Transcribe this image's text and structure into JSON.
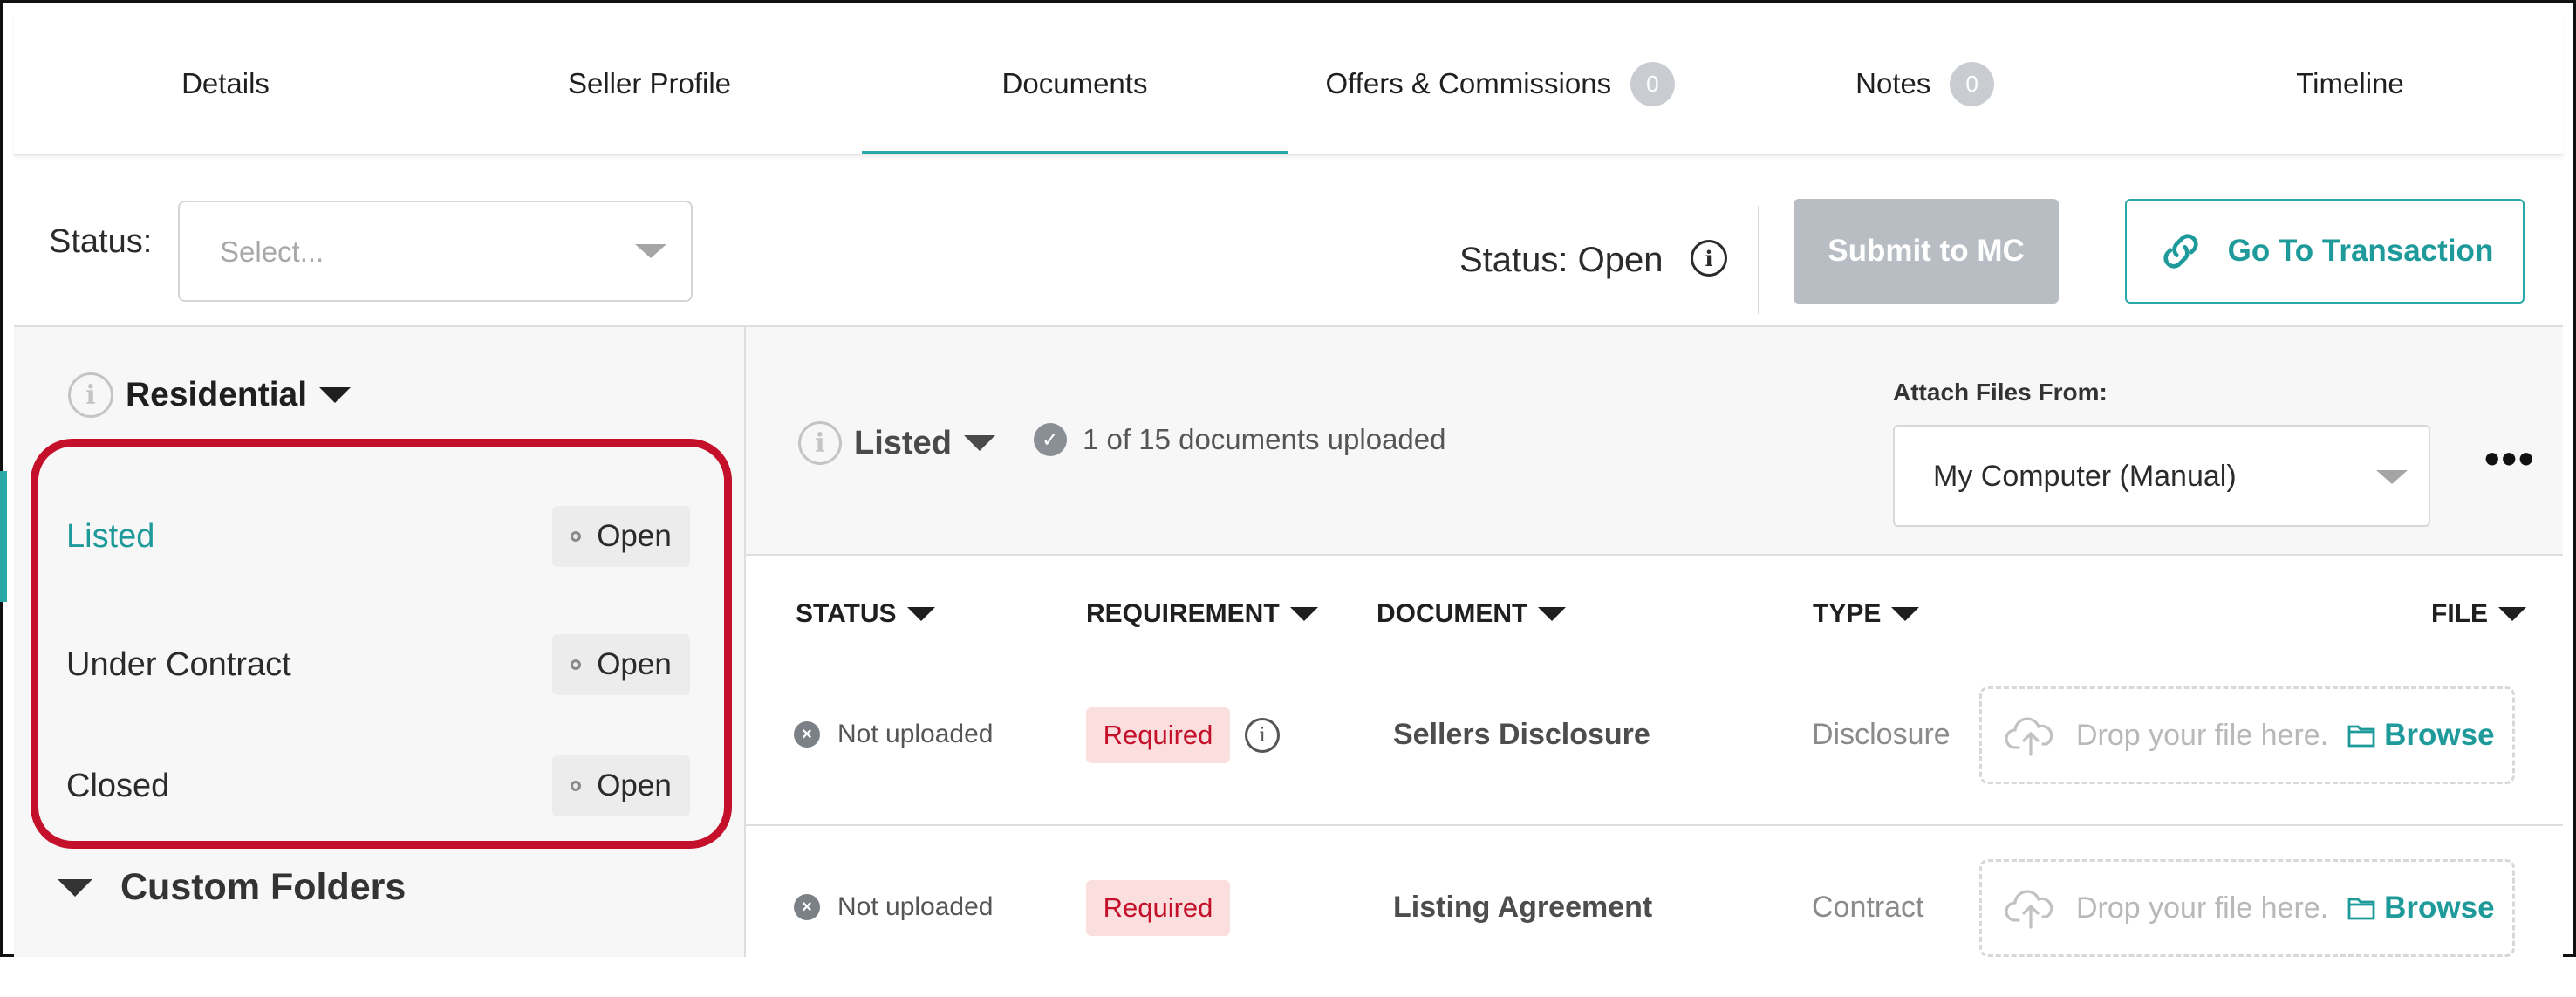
{
  "tabs": [
    {
      "label": "Details"
    },
    {
      "label": "Seller Profile"
    },
    {
      "label": "Documents",
      "active": true
    },
    {
      "label": "Offers & Commissions",
      "badge": "0"
    },
    {
      "label": "Notes",
      "badge": "0"
    },
    {
      "label": "Timeline"
    }
  ],
  "statusbar": {
    "label": "Status:",
    "select_placeholder": "Select...",
    "status_text": "Status: Open",
    "submit_label": "Submit to MC",
    "goto_label": "Go To Transaction"
  },
  "sidebar": {
    "group": "Residential",
    "items": [
      {
        "label": "Listed",
        "status": "Open",
        "active": true
      },
      {
        "label": "Under Contract",
        "status": "Open"
      },
      {
        "label": "Closed",
        "status": "Open"
      }
    ],
    "custom_folders": "Custom Folders"
  },
  "docs": {
    "folder": "Listed",
    "uploaded_text": "1 of 15 documents uploaded",
    "attach_label": "Attach Files From:",
    "attach_value": "My Computer (Manual)",
    "columns": [
      "STATUS",
      "REQUIREMENT",
      "DOCUMENT",
      "TYPE",
      "FILE"
    ],
    "rows": [
      {
        "status": "Not uploaded",
        "requirement": "Required",
        "document": "Sellers Disclosure",
        "type": "Disclosure",
        "drop_text": "Drop your file here.",
        "browse": "Browse"
      },
      {
        "status": "Not uploaded",
        "requirement": "Required",
        "document": "Listing Agreement",
        "type": "Contract",
        "drop_text": "Drop your file here.",
        "browse": "Browse"
      }
    ]
  },
  "colors": {
    "accent": "#2aa7a7",
    "highlight": "#c4102a",
    "required_bg": "#fbdede"
  },
  "icons": [
    "info-icon",
    "caret-down-icon",
    "link-icon",
    "check-circle-icon",
    "x-circle-icon",
    "cloud-upload-icon",
    "folder-icon",
    "more-icon"
  ]
}
